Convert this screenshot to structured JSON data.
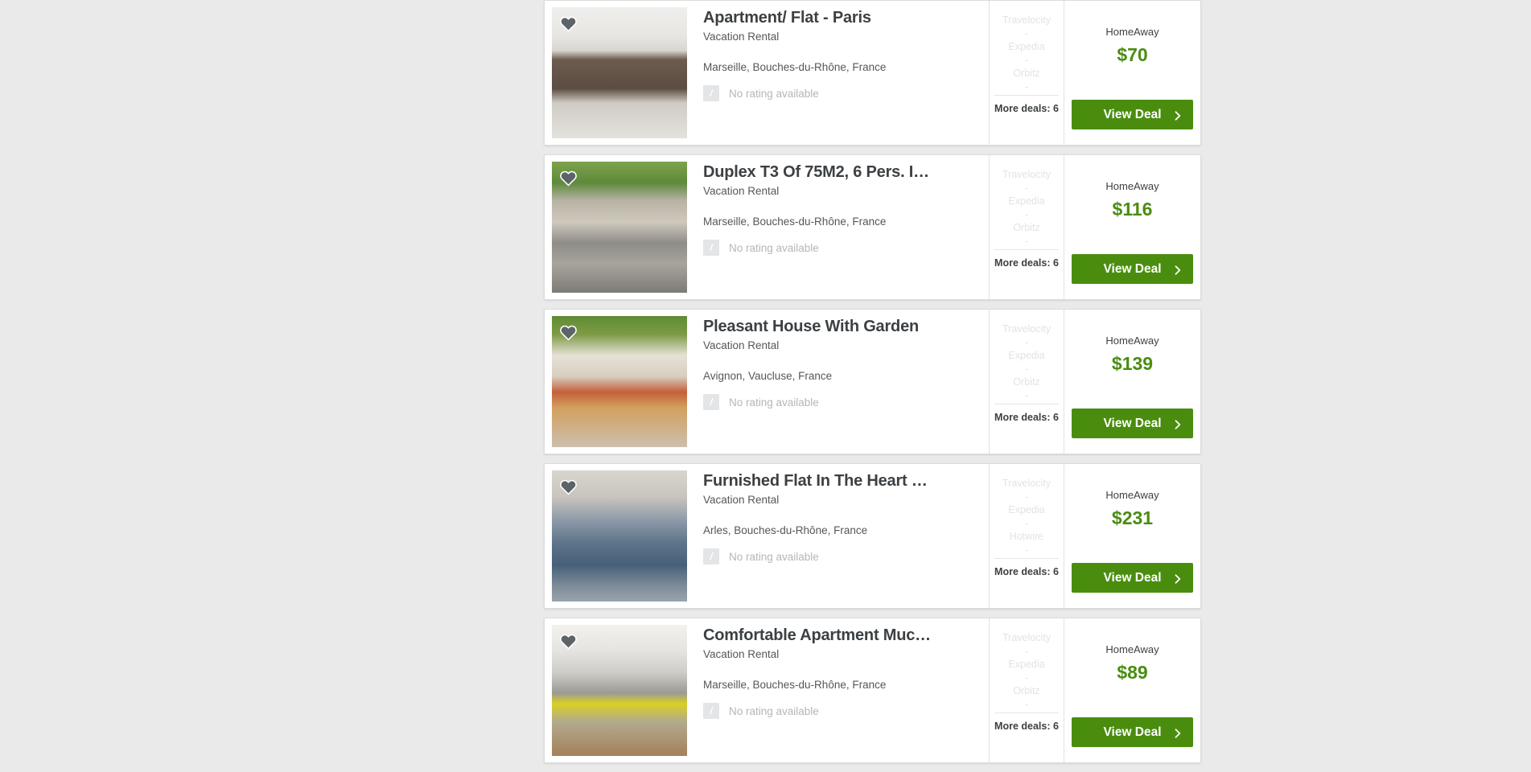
{
  "page": {
    "background_color": "#eaeaeb",
    "accent_green": "#4a8d0e",
    "price_green": "#4a8d10"
  },
  "labels": {
    "more_deals_prefix": "More deals:",
    "view_deal": "View Deal",
    "no_rating": "No rating available",
    "rating_badge_glyph": "/",
    "heart_icon": "heart-icon",
    "chevron_icon": "chevron-right-icon"
  },
  "results": [
    {
      "title": "Apartment/ Flat - Paris",
      "subtitle": "Vacation Rental",
      "location": "Marseille, Bouches-du-Rhône, France",
      "rating_badge": "/",
      "rating_text": "No rating available",
      "providers": [
        {
          "name": "Travelocity",
          "price": "-"
        },
        {
          "name": "Expedia",
          "price": "-"
        },
        {
          "name": "Orbitz",
          "price": "-"
        }
      ],
      "more_deals_label": "More deals: 6",
      "more_deals_count": 6,
      "deal_provider": "HomeAway",
      "deal_price": "$70",
      "view_deal_label": "View Deal",
      "image": {
        "kind": "kitchen",
        "alt": "Modern kitchen with microwave and dark wood cabinets"
      }
    },
    {
      "title": "Duplex T3 Of 75M2, 6 Pers. I…",
      "subtitle": "Vacation Rental",
      "location": "Marseille, Bouches-du-Rhône, France",
      "rating_badge": "/",
      "rating_text": "No rating available",
      "providers": [
        {
          "name": "Travelocity",
          "price": "-"
        },
        {
          "name": "Expedia",
          "price": "-"
        },
        {
          "name": "Orbitz",
          "price": "-"
        }
      ],
      "more_deals_label": "More deals: 6",
      "more_deals_count": 6,
      "deal_provider": "HomeAway",
      "deal_price": "$116",
      "view_deal_label": "View Deal",
      "image": {
        "kind": "alley",
        "alt": "Narrow cobbled alley with green plants and blue shutters"
      }
    },
    {
      "title": "Pleasant House With Garden",
      "subtitle": "Vacation Rental",
      "location": "Avignon, Vaucluse, France",
      "rating_badge": "/",
      "rating_text": "No rating available",
      "providers": [
        {
          "name": "Travelocity",
          "price": "-"
        },
        {
          "name": "Expedia",
          "price": "-"
        },
        {
          "name": "Orbitz",
          "price": "-"
        }
      ],
      "more_deals_label": "More deals: 6",
      "more_deals_count": 6,
      "deal_provider": "HomeAway",
      "deal_price": "$139",
      "view_deal_label": "View Deal",
      "image": {
        "kind": "terrace",
        "alt": "Shaded terrace with orange chairs and canopy"
      }
    },
    {
      "title": "Furnished Flat In The Heart …",
      "subtitle": "Vacation Rental",
      "location": "Arles, Bouches-du-Rhône, France",
      "rating_badge": "/",
      "rating_text": "No rating available",
      "providers": [
        {
          "name": "Travelocity",
          "price": "-"
        },
        {
          "name": "Expedia",
          "price": "-"
        },
        {
          "name": "Hotwire",
          "price": "-"
        }
      ],
      "more_deals_label": "More deals: 6",
      "more_deals_count": 6,
      "deal_provider": "HomeAway",
      "deal_price": "$231",
      "view_deal_label": "View Deal",
      "image": {
        "kind": "livingroom-blue",
        "alt": "Living room with blue sofas and chandelier"
      }
    },
    {
      "title": "Comfortable Apartment Muc…",
      "subtitle": "Vacation Rental",
      "location": "Marseille, Bouches-du-Rhône, France",
      "rating_badge": "/",
      "rating_text": "No rating available",
      "providers": [
        {
          "name": "Travelocity",
          "price": "-"
        },
        {
          "name": "Expedia",
          "price": "-"
        },
        {
          "name": "Orbitz",
          "price": "-"
        }
      ],
      "more_deals_label": "More deals: 6",
      "more_deals_count": 6,
      "deal_provider": "HomeAway",
      "deal_price": "$89",
      "view_deal_label": "View Deal",
      "image": {
        "kind": "livingroom-yellow",
        "alt": "Living room with yellow ottoman and grey sofa"
      }
    }
  ]
}
